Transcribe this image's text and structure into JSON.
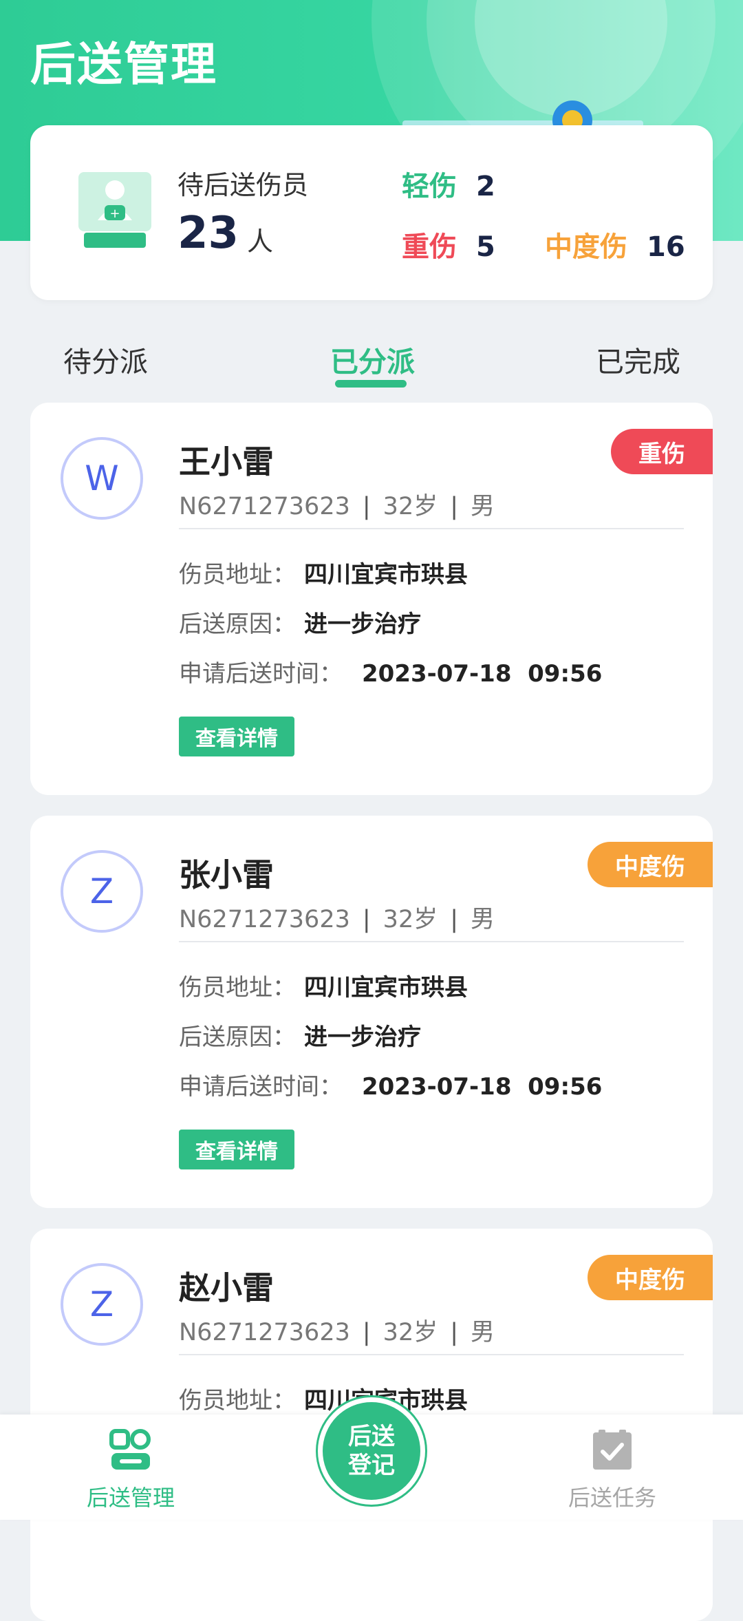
{
  "header": {
    "title": "后送管理"
  },
  "summary": {
    "label": "待后送伤员",
    "count": "23",
    "unit": "人",
    "light_label": "轻伤",
    "light_value": "2",
    "severe_label": "重伤",
    "severe_value": "5",
    "moderate_label": "中度伤",
    "moderate_value": "16"
  },
  "tabs": [
    {
      "label": "待分派"
    },
    {
      "label": "已分派",
      "active": true
    },
    {
      "label": "已完成"
    }
  ],
  "cards": [
    {
      "initial": "W",
      "name": "王小雷",
      "id": "N6271273623",
      "age": "32岁",
      "gender": "男",
      "badge": "重伤",
      "address_label": "伤员地址：",
      "address": "四川宜宾市珙县",
      "reason_label": "后送原因：",
      "reason": "进一步治疗",
      "time_label": "申请后送时间：",
      "time": "2023-07-18  09:56",
      "button": "查看详情"
    },
    {
      "initial": "Z",
      "name": "张小雷",
      "id": "N6271273623",
      "age": "32岁",
      "gender": "男",
      "badge": "中度伤",
      "address_label": "伤员地址：",
      "address": "四川宜宾市珙县",
      "reason_label": "后送原因：",
      "reason": "进一步治疗",
      "time_label": "申请后送时间：",
      "time": "2023-07-18  09:56",
      "button": "查看详情"
    },
    {
      "initial": "Z",
      "name": "赵小雷",
      "id": "N6271273623",
      "age": "32岁",
      "gender": "男",
      "badge": "中度伤",
      "address_label": "伤员地址：",
      "address": "四川宜宾市珙县"
    }
  ],
  "bottom_nav": {
    "left_label": "后送管理",
    "center_line1": "后送",
    "center_line2": "登记",
    "right_label": "后送任务"
  },
  "colors": {
    "primary": "#2fbd85",
    "severe": "#ef4a57",
    "moderate": "#f7a23a",
    "avatar_ring": "#c3cafb"
  }
}
